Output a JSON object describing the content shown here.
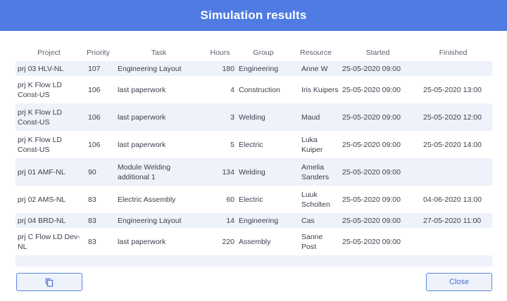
{
  "dialog": {
    "title": "Simulation results"
  },
  "table": {
    "columns": [
      "Project",
      "Priority",
      "Task",
      "Hours",
      "Group",
      "Resource",
      "Started",
      "Finished"
    ],
    "rows": [
      {
        "project": "prj 03 HLV-NL",
        "priority": "107",
        "task": "Engineering Layout",
        "hours": "180",
        "group": "Engineering",
        "resource": "Anne W",
        "started": "25-05-2020 09:00",
        "finished": ""
      },
      {
        "project": "prj K Flow LD Const-US",
        "priority": "106",
        "task": "last paperwork",
        "hours": "4",
        "group": "Construction",
        "resource": "Iris Kuipers",
        "started": "25-05-2020 09:00",
        "finished": "25-05-2020 13:00"
      },
      {
        "project": "prj K Flow LD Const-US",
        "priority": "106",
        "task": "last paperwork",
        "hours": "3",
        "group": "Welding",
        "resource": "Maud",
        "started": "25-05-2020 09:00",
        "finished": "25-05-2020 12:00"
      },
      {
        "project": "prj K Flow LD Const-US",
        "priority": "106",
        "task": "last paperwork",
        "hours": "5",
        "group": "Electric",
        "resource": "Luka Kuiper",
        "started": "25-05-2020 09:00",
        "finished": "25-05-2020 14:00"
      },
      {
        "project": "prj 01 AMF-NL",
        "priority": "90",
        "task": "Module Welding additional 1",
        "hours": "134",
        "group": "Welding",
        "resource": "Amelia Sanders",
        "started": "25-05-2020 09:00",
        "finished": ""
      },
      {
        "project": "prj 02 AMS-NL",
        "priority": "83",
        "task": "Electric Assembly",
        "hours": "60",
        "group": "Electric",
        "resource": "Luuk Scholten",
        "started": "25-05-2020 09:00",
        "finished": "04-06-2020 13:00"
      },
      {
        "project": "prj 04 BRD-NL",
        "priority": "83",
        "task": "Engineering Layout",
        "hours": "14",
        "group": "Engineering",
        "resource": "Cas",
        "started": "25-05-2020 09:00",
        "finished": "27-05-2020 11:00"
      },
      {
        "project": "prj C Flow LD Dev-NL",
        "priority": "83",
        "task": "last paperwork",
        "hours": "220",
        "group": "Assembly",
        "resource": "Sanne Post",
        "started": "25-05-2020 09:00",
        "finished": ""
      }
    ]
  },
  "footer": {
    "copy_icon": "copy-icon",
    "close_label": "Close"
  },
  "colors": {
    "header": "#4f7be3",
    "row_stripe": "#eef2fa",
    "button_border": "#5d86e4",
    "button_text": "#4a72d6"
  }
}
